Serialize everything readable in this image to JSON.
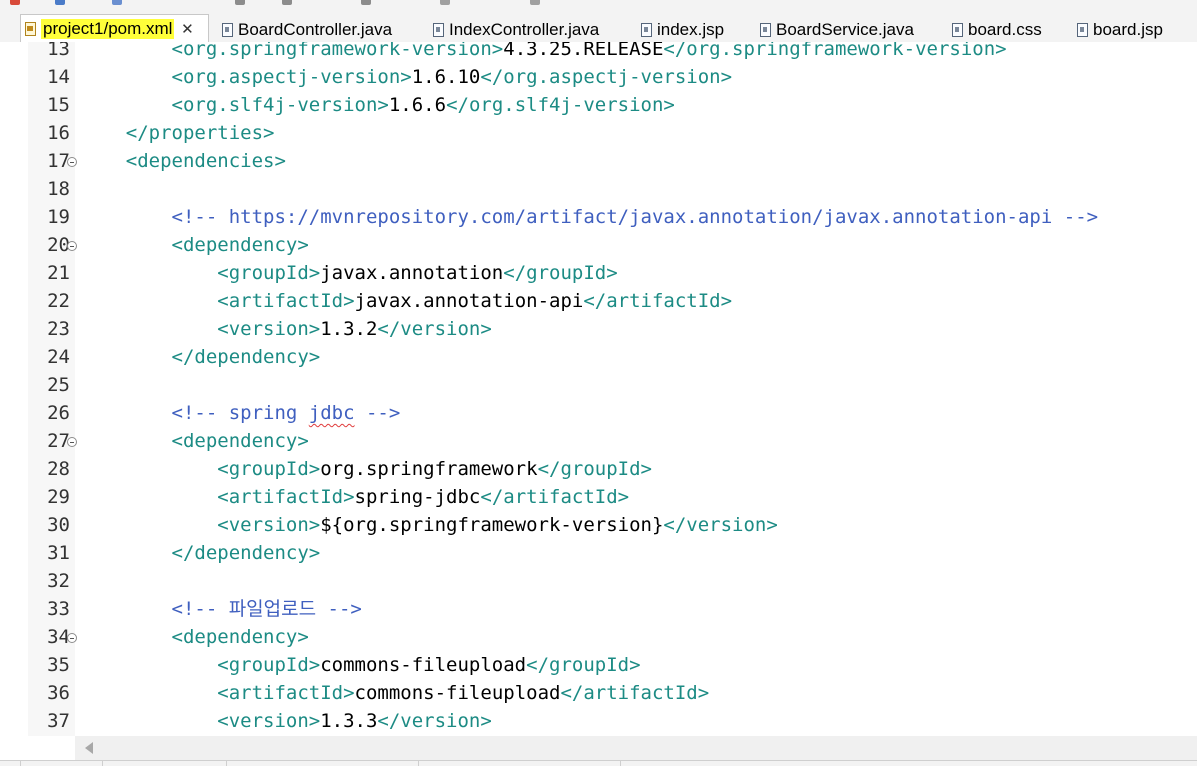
{
  "tabs": [
    {
      "label": "project1/pom.xml",
      "icon": "xml-file-icon",
      "active": true,
      "highlighted": true,
      "close": "✕"
    },
    {
      "label": "BoardController.java",
      "icon": "java-file-icon"
    },
    {
      "label": "IndexController.java",
      "icon": "java-file-icon"
    },
    {
      "label": "index.jsp",
      "icon": "jsp-file-icon"
    },
    {
      "label": "BoardService.java",
      "icon": "java-file-icon"
    },
    {
      "label": "board.css",
      "icon": "css-file-icon"
    },
    {
      "label": "board.jsp",
      "icon": "jsp-file-icon"
    }
  ],
  "editor": {
    "lines": [
      {
        "num": "13",
        "fold": false
      },
      {
        "num": "14",
        "fold": false
      },
      {
        "num": "15",
        "fold": false
      },
      {
        "num": "16",
        "fold": false
      },
      {
        "num": "17",
        "fold": true
      },
      {
        "num": "18",
        "fold": false
      },
      {
        "num": "19",
        "fold": false
      },
      {
        "num": "20",
        "fold": true
      },
      {
        "num": "21",
        "fold": false
      },
      {
        "num": "22",
        "fold": false
      },
      {
        "num": "23",
        "fold": false
      },
      {
        "num": "24",
        "fold": false
      },
      {
        "num": "25",
        "fold": false
      },
      {
        "num": "26",
        "fold": false
      },
      {
        "num": "27",
        "fold": true
      },
      {
        "num": "28",
        "fold": false
      },
      {
        "num": "29",
        "fold": false
      },
      {
        "num": "30",
        "fold": false
      },
      {
        "num": "31",
        "fold": false
      },
      {
        "num": "32",
        "fold": false
      },
      {
        "num": "33",
        "fold": false
      },
      {
        "num": "34",
        "fold": true
      },
      {
        "num": "35",
        "fold": false
      },
      {
        "num": "36",
        "fold": false
      },
      {
        "num": "37",
        "fold": false
      }
    ],
    "code": {
      "l13_open": "        <org.springframework-version>",
      "l13_val": "4.3.25.RELEASE",
      "l13_close": "</org.springframework-version>",
      "l14_open": "        <org.aspectj-version>",
      "l14_val": "1.6.10",
      "l14_close": "</org.aspectj-version>",
      "l15_open": "        <org.slf4j-version>",
      "l15_val": "1.6.6",
      "l15_close": "</org.slf4j-version>",
      "l16": "    </properties>",
      "l17": "    <dependencies>",
      "l19": "        <!-- https://mvnrepository.com/artifact/javax.annotation/javax.annotation-api -->",
      "l20": "        <dependency>",
      "l21_open": "            <groupId>",
      "l21_val": "javax.annotation",
      "l21_close": "</groupId>",
      "l22_open": "            <artifactId>",
      "l22_val": "javax.annotation-api",
      "l22_close": "</artifactId>",
      "l23_open": "            <version>",
      "l23_val": "1.3.2",
      "l23_close": "</version>",
      "l24": "        </dependency>",
      "l26_a": "        <!-- spring ",
      "l26_b": "jdbc",
      "l26_c": " -->",
      "l27": "        <dependency>",
      "l28_open": "            <groupId>",
      "l28_val": "org.springframework",
      "l28_close": "</groupId>",
      "l29_open": "            <artifactId>",
      "l29_val": "spring-jdbc",
      "l29_close": "</artifactId>",
      "l30_open": "            <version>",
      "l30_val": "${org.springframework-version}",
      "l30_close": "</version>",
      "l31": "        </dependency>",
      "l33": "        <!-- 파일업로드 -->",
      "l34": "        <dependency>",
      "l35_open": "            <groupId>",
      "l35_val": "commons-fileupload",
      "l35_close": "</groupId>",
      "l36_open": "            <artifactId>",
      "l36_val": "commons-fileupload",
      "l36_close": "</artifactId>",
      "l37_open": "            <version>",
      "l37_val": "1.3.3",
      "l37_close": "</version>"
    }
  },
  "colors": {
    "tag": "#1c8b84",
    "comment": "#3f5fbf",
    "text": "#000000",
    "tab_highlight": "#ffff3a",
    "spell_error": "#e03b3b"
  }
}
